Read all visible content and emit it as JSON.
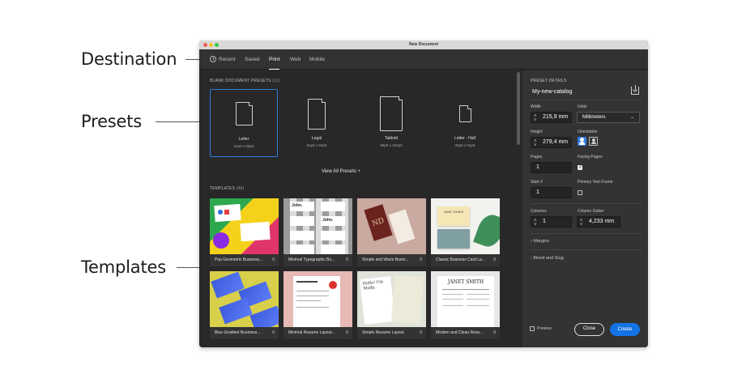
{
  "annotations": {
    "destination": "Destination",
    "presets": "Presets",
    "templates": "Templates"
  },
  "window": {
    "title": "New Document"
  },
  "tabs": [
    {
      "label": "Recent",
      "active": false
    },
    {
      "label": "Saved",
      "active": false
    },
    {
      "label": "Print",
      "active": true
    },
    {
      "label": "Web",
      "active": false
    },
    {
      "label": "Mobile",
      "active": false
    }
  ],
  "presets_section": {
    "title": "BLANK DOCUMENT PRESETS",
    "count": "(11)",
    "items": [
      {
        "name": "Letter",
        "size": "51p0 x 66p0",
        "selected": true
      },
      {
        "name": "Legal",
        "size": "51p0 x 84p0",
        "selected": false
      },
      {
        "name": "Tabloid",
        "size": "66p0 x 102p0",
        "selected": false
      },
      {
        "name": "Letter - Half",
        "size": "33p0 x 51p0",
        "selected": false
      }
    ],
    "view_all": "View All Presets +"
  },
  "templates_section": {
    "title": "TEMPLATES",
    "count": "(46)",
    "items": [
      {
        "name": "Pop Geometric Business...",
        "count": "0"
      },
      {
        "name": "Minimal Typographic Bu...",
        "count": "0"
      },
      {
        "name": "Simple and Warm Busin...",
        "count": "0"
      },
      {
        "name": "Classic Business Card La...",
        "count": "0"
      },
      {
        "name": "Blue Gradient Business...",
        "count": "0"
      },
      {
        "name": "Minimal Resume Layout...",
        "count": "0"
      },
      {
        "name": "Simple Resume Layout",
        "count": "0"
      },
      {
        "name": "Modern and Clean Resu...",
        "count": "0"
      }
    ],
    "thumb_text": {
      "john": "John.",
      "nd": "ND",
      "jane_jones": "JANE JONES",
      "janet_smith": "JANET SMITH",
      "hello": "Hello! I'm Molly."
    }
  },
  "details": {
    "title": "PRESET DETAILS",
    "doc_name": "My-new-catalog",
    "width_label": "Width",
    "width_value": "215,9 mm",
    "units_label": "Units",
    "units_value": "Millimeters",
    "height_label": "Height",
    "height_value": "279,4 mm",
    "orientation_label": "Orientation",
    "pages_label": "Pages",
    "pages_value": "1",
    "facing_label": "Facing Pages",
    "facing_checked": true,
    "start_label": "Start #",
    "start_value": "1",
    "primary_label": "Primary Text Frame",
    "primary_checked": false,
    "columns_label": "Columns",
    "columns_value": "1",
    "gutter_label": "Column Gutter",
    "gutter_value": "4,233 mm",
    "margins_label": "Margins",
    "bleed_label": "Bleed and Slug",
    "preview_label": "Preview",
    "close_label": "Close",
    "create_label": "Create"
  },
  "colors": {
    "accent": "#1473e6",
    "selection": "#2f7ce0"
  }
}
